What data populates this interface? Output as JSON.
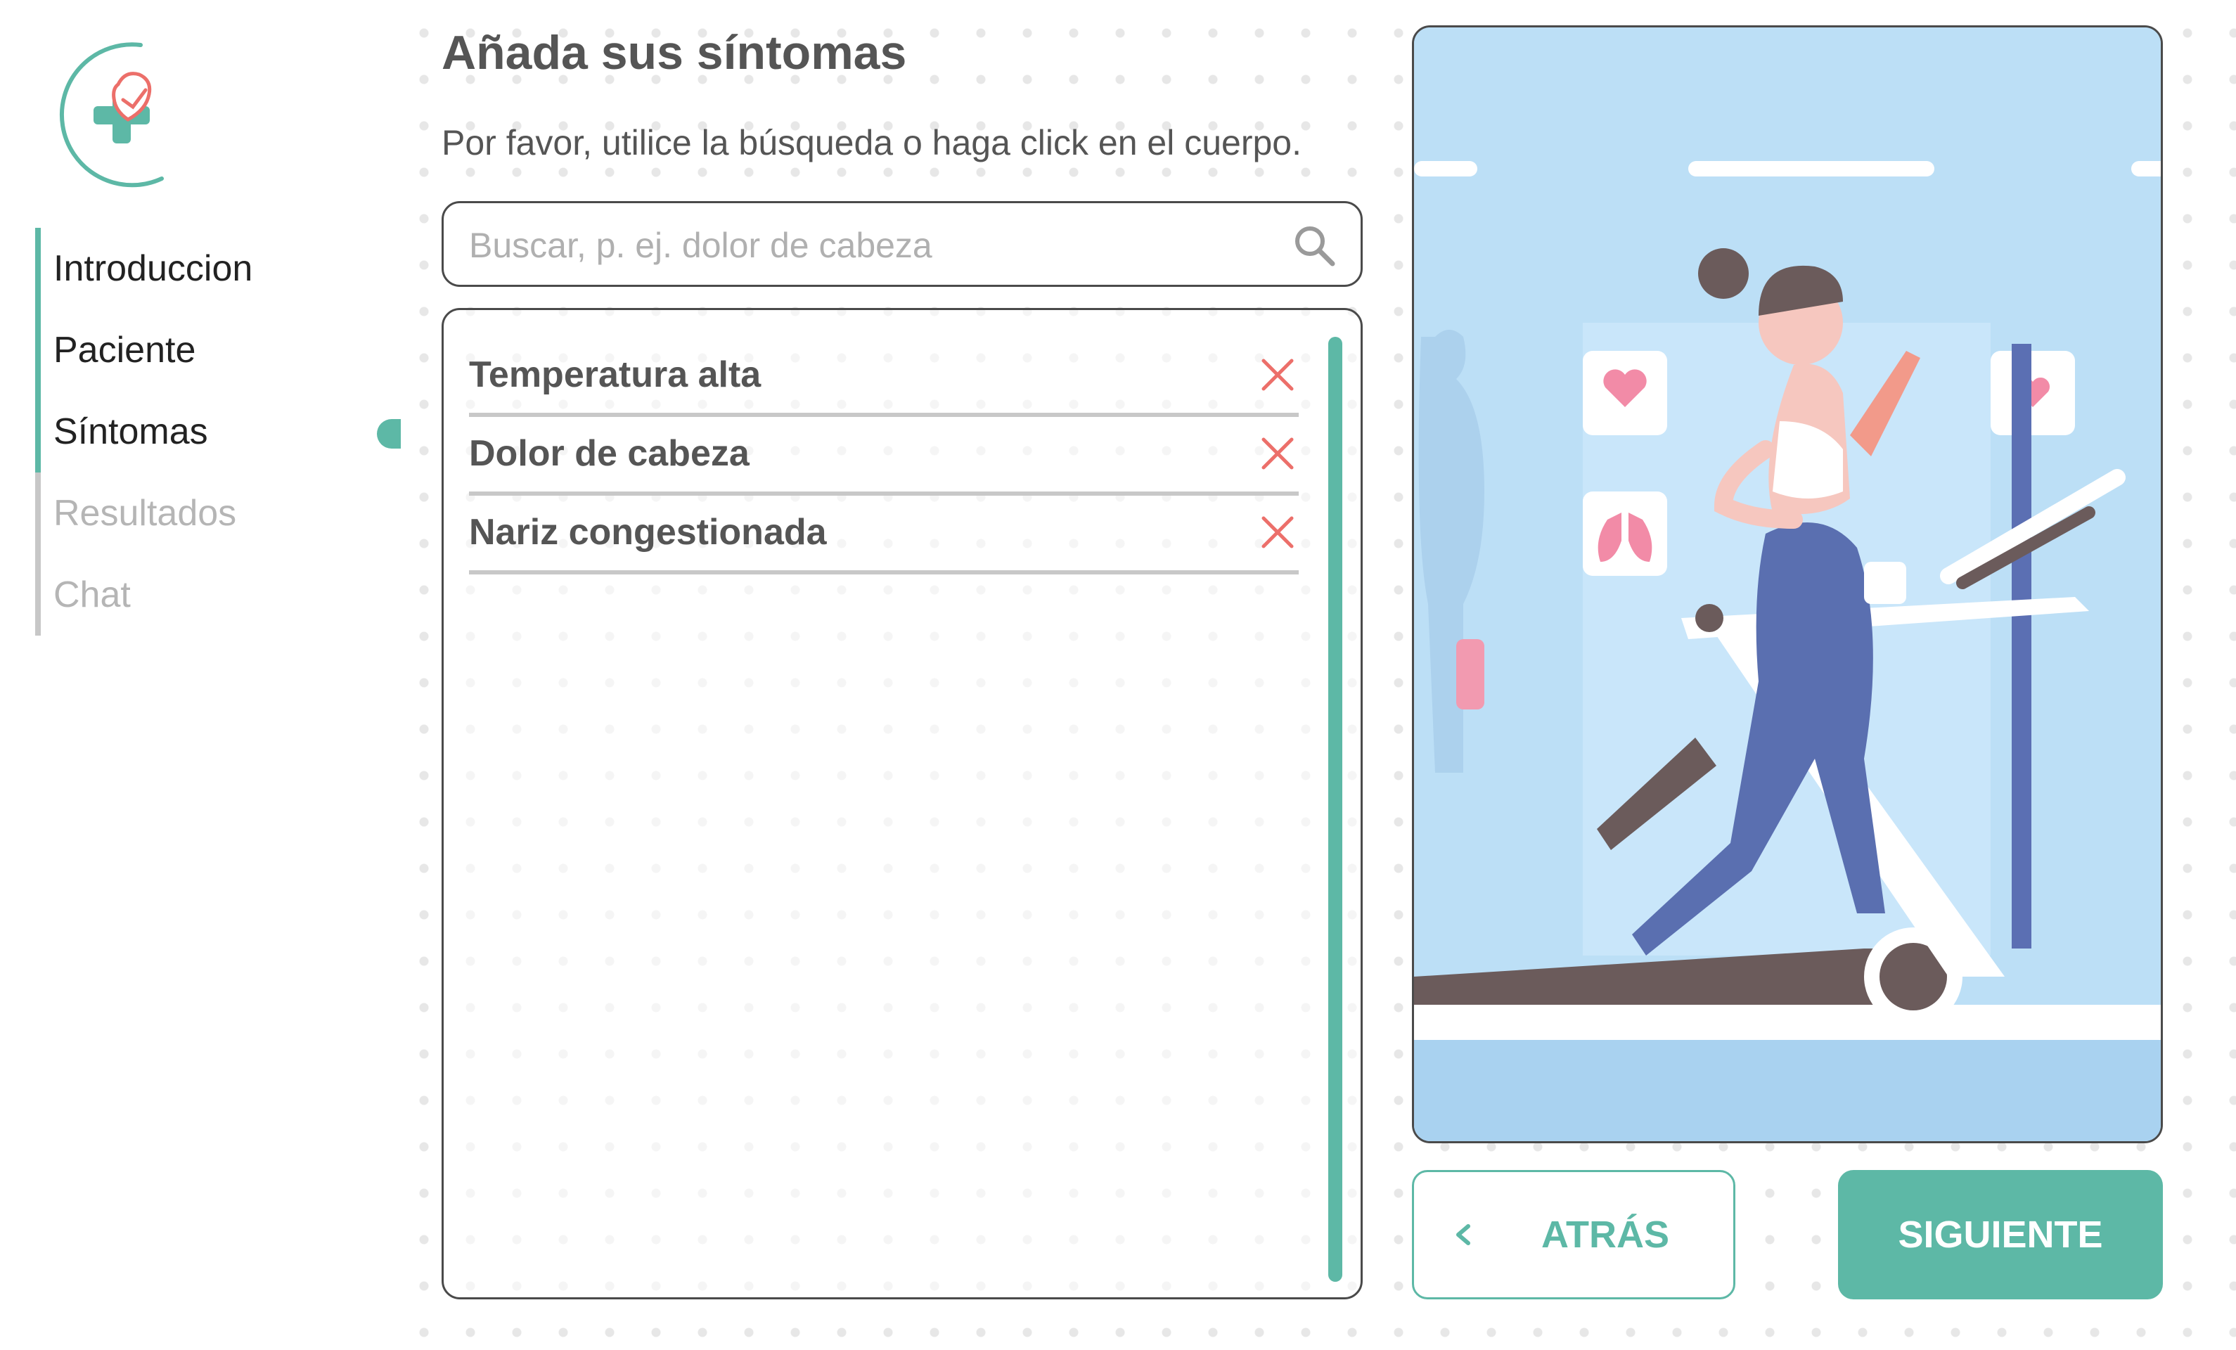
{
  "nav": {
    "items": [
      {
        "label": "Introduccion",
        "state": "done"
      },
      {
        "label": "Paciente",
        "state": "done"
      },
      {
        "label": "Síntomas",
        "state": "current"
      },
      {
        "label": "Resultados",
        "state": "pending"
      },
      {
        "label": "Chat",
        "state": "pending"
      }
    ]
  },
  "main": {
    "title": "Añada sus síntomas",
    "subtitle": "Por favor, utilice la búsqueda o haga click en el cuerpo.",
    "search": {
      "placeholder": "Buscar, p. ej. dolor de cabeza",
      "value": "",
      "icon": "search-icon"
    },
    "symptoms": [
      {
        "label": "Temperatura alta"
      },
      {
        "label": "Dolor de cabeza"
      },
      {
        "label": "Nariz congestionada"
      }
    ]
  },
  "buttons": {
    "back_label": "ATRÁS",
    "next_label": "SIGUIENTE"
  },
  "colors": {
    "accent": "#5db8a6",
    "remove": "#ec6f6a",
    "illustration_bg": "#bcdff6"
  }
}
